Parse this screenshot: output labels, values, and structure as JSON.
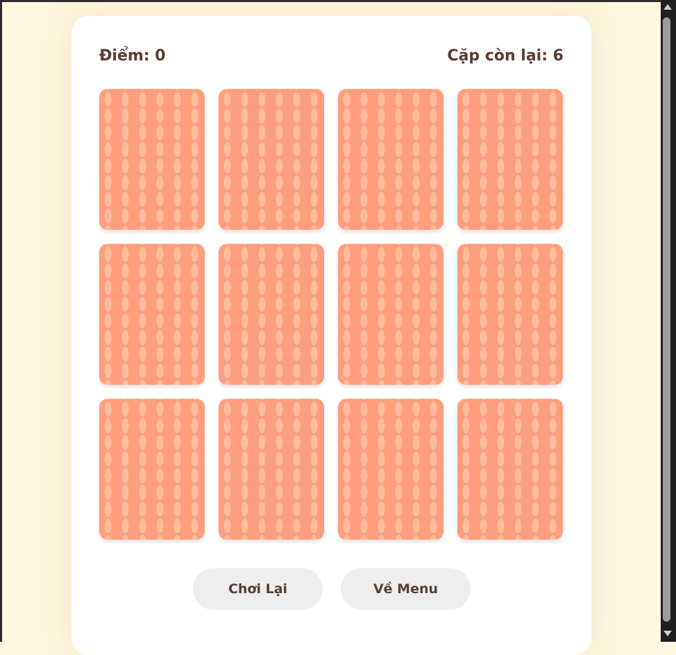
{
  "game": {
    "score_label": "Điểm: 0",
    "score": 0,
    "pairs_label": "Cặp còn lại: 6",
    "pairs_remaining": 6
  },
  "cards": [
    {
      "state": "face-down"
    },
    {
      "state": "face-down"
    },
    {
      "state": "face-down"
    },
    {
      "state": "face-down"
    },
    {
      "state": "face-down"
    },
    {
      "state": "face-down"
    },
    {
      "state": "face-down"
    },
    {
      "state": "face-down"
    },
    {
      "state": "face-down"
    },
    {
      "state": "face-down"
    },
    {
      "state": "face-down"
    },
    {
      "state": "face-down"
    }
  ],
  "buttons": {
    "replay": "Chơi Lại",
    "menu": "Về Menu"
  },
  "colors": {
    "page_background": "#fdf6e0",
    "panel_background": "#ffffff",
    "card_back": "#ff9e7c",
    "card_pattern": "#ffbc9d",
    "text": "#5a3d33",
    "button_background": "#eeeeee"
  }
}
